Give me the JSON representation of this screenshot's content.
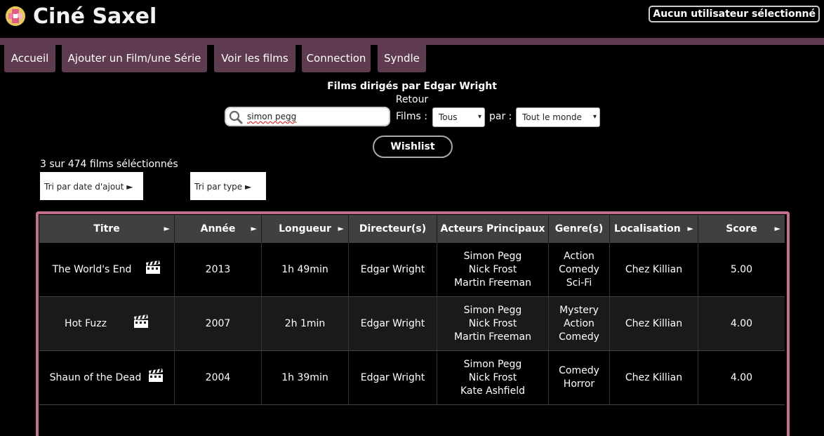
{
  "app": {
    "title": "Ciné Saxel",
    "logo_icon": "film-reel-icon"
  },
  "user": {
    "label": "Aucun utilisateur sélectionné"
  },
  "nav": {
    "items": [
      "Accueil",
      "Ajouter un Film/une Série",
      "Voir les films",
      "Connection",
      "Syndle"
    ]
  },
  "page": {
    "subtitle": "Films dirigés par Edgar Wright",
    "back_link": "Retour"
  },
  "search": {
    "value": "simon pegg",
    "icon": "search-icon"
  },
  "filters": {
    "films_label": "Films :",
    "films_value": "Tous",
    "by_label": "par :",
    "by_value": "Tout le monde"
  },
  "wishlist_label": "Wishlist",
  "count_text": "3 sur 474 films séléctionnés",
  "sort": {
    "by_date": "Tri par date d'ajout ►",
    "by_type": "Tri par type ►"
  },
  "table": {
    "headers": [
      "Titre",
      "Année",
      "Longueur",
      "Directeur(s)",
      "Acteurs Principaux",
      "Genre(s)",
      "Localisation",
      "Score"
    ],
    "sortable_arrow": "►",
    "rows": [
      {
        "title": "The World's End",
        "year": "2013",
        "length": "1h 49min",
        "director": "Edgar Wright",
        "actors": [
          "Simon Pegg",
          "Nick Frost",
          "Martin Freeman"
        ],
        "genres": [
          "Action",
          "Comedy",
          "Sci-Fi"
        ],
        "location": "Chez Killian",
        "score": "5.00"
      },
      {
        "title": "Hot Fuzz",
        "year": "2007",
        "length": "2h 1min",
        "director": "Edgar Wright",
        "actors": [
          "Simon Pegg",
          "Nick Frost",
          "Martin Freeman"
        ],
        "genres": [
          "Mystery",
          "Action",
          "Comedy"
        ],
        "location": "Chez Killian",
        "score": "4.00"
      },
      {
        "title": "Shaun of the Dead",
        "year": "2004",
        "length": "1h 39min",
        "director": "Edgar Wright",
        "actors": [
          "Simon Pegg",
          "Nick Frost",
          "Kate Ashfield"
        ],
        "genres": [
          "Comedy",
          "Horror"
        ],
        "location": "Chez Killian",
        "score": "4.00"
      }
    ]
  },
  "colors": {
    "accent": "#5f3b4f",
    "frame": "#c36e91",
    "header_bg": "#404040",
    "row_alt": "#1a1a1a"
  }
}
